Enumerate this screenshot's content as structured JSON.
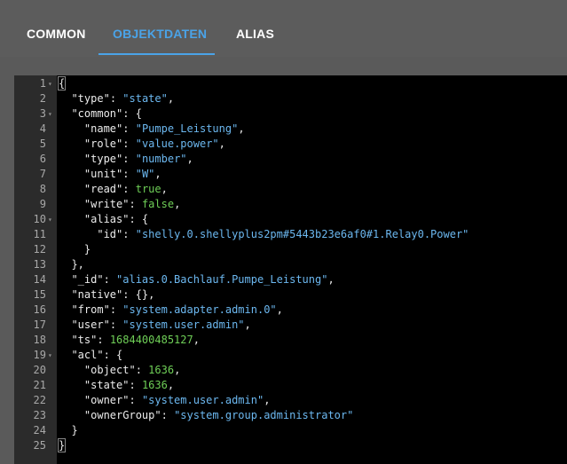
{
  "tabs": [
    {
      "label": "COMMON",
      "active": false
    },
    {
      "label": "OBJEKTDATEN",
      "active": true
    },
    {
      "label": "ALIAS",
      "active": false
    }
  ],
  "colors": {
    "accent": "#4aa3e8",
    "string": "#6cb8f0",
    "number": "#6fcf57",
    "key": "#ececec"
  },
  "lines": [
    {
      "num": "1",
      "fold": true,
      "tokens": [
        {
          "t": "p",
          "v": "{"
        }
      ]
    },
    {
      "num": "2",
      "fold": false,
      "tokens": [
        {
          "t": "p",
          "v": "  "
        },
        {
          "t": "k",
          "v": "\"type\""
        },
        {
          "t": "p",
          "v": ": "
        },
        {
          "t": "s",
          "v": "\"state\""
        },
        {
          "t": "p",
          "v": ","
        }
      ]
    },
    {
      "num": "3",
      "fold": true,
      "tokens": [
        {
          "t": "p",
          "v": "  "
        },
        {
          "t": "k",
          "v": "\"common\""
        },
        {
          "t": "p",
          "v": ": {"
        }
      ]
    },
    {
      "num": "4",
      "fold": false,
      "tokens": [
        {
          "t": "p",
          "v": "    "
        },
        {
          "t": "k",
          "v": "\"name\""
        },
        {
          "t": "p",
          "v": ": "
        },
        {
          "t": "s",
          "v": "\"Pumpe_Leistung\""
        },
        {
          "t": "p",
          "v": ","
        }
      ]
    },
    {
      "num": "5",
      "fold": false,
      "tokens": [
        {
          "t": "p",
          "v": "    "
        },
        {
          "t": "k",
          "v": "\"role\""
        },
        {
          "t": "p",
          "v": ": "
        },
        {
          "t": "s",
          "v": "\"value.power\""
        },
        {
          "t": "p",
          "v": ","
        }
      ]
    },
    {
      "num": "6",
      "fold": false,
      "tokens": [
        {
          "t": "p",
          "v": "    "
        },
        {
          "t": "k",
          "v": "\"type\""
        },
        {
          "t": "p",
          "v": ": "
        },
        {
          "t": "s",
          "v": "\"number\""
        },
        {
          "t": "p",
          "v": ","
        }
      ]
    },
    {
      "num": "7",
      "fold": false,
      "tokens": [
        {
          "t": "p",
          "v": "    "
        },
        {
          "t": "k",
          "v": "\"unit\""
        },
        {
          "t": "p",
          "v": ": "
        },
        {
          "t": "s",
          "v": "\"W\""
        },
        {
          "t": "p",
          "v": ","
        }
      ]
    },
    {
      "num": "8",
      "fold": false,
      "tokens": [
        {
          "t": "p",
          "v": "    "
        },
        {
          "t": "k",
          "v": "\"read\""
        },
        {
          "t": "p",
          "v": ": "
        },
        {
          "t": "b",
          "v": "true"
        },
        {
          "t": "p",
          "v": ","
        }
      ]
    },
    {
      "num": "9",
      "fold": false,
      "tokens": [
        {
          "t": "p",
          "v": "    "
        },
        {
          "t": "k",
          "v": "\"write\""
        },
        {
          "t": "p",
          "v": ": "
        },
        {
          "t": "b",
          "v": "false"
        },
        {
          "t": "p",
          "v": ","
        }
      ]
    },
    {
      "num": "10",
      "fold": true,
      "tokens": [
        {
          "t": "p",
          "v": "    "
        },
        {
          "t": "k",
          "v": "\"alias\""
        },
        {
          "t": "p",
          "v": ": {"
        }
      ]
    },
    {
      "num": "11",
      "fold": false,
      "tokens": [
        {
          "t": "p",
          "v": "      "
        },
        {
          "t": "k",
          "v": "\"id\""
        },
        {
          "t": "p",
          "v": ": "
        },
        {
          "t": "s",
          "v": "\"shelly.0.shellyplus2pm#5443b23e6af0#1.Relay0.Power\""
        }
      ]
    },
    {
      "num": "12",
      "fold": false,
      "tokens": [
        {
          "t": "p",
          "v": "    }"
        }
      ]
    },
    {
      "num": "13",
      "fold": false,
      "tokens": [
        {
          "t": "p",
          "v": "  },"
        }
      ]
    },
    {
      "num": "14",
      "fold": false,
      "tokens": [
        {
          "t": "p",
          "v": "  "
        },
        {
          "t": "k",
          "v": "\"_id\""
        },
        {
          "t": "p",
          "v": ": "
        },
        {
          "t": "s",
          "v": "\"alias.0.Bachlauf.Pumpe_Leistung\""
        },
        {
          "t": "p",
          "v": ","
        }
      ]
    },
    {
      "num": "15",
      "fold": false,
      "tokens": [
        {
          "t": "p",
          "v": "  "
        },
        {
          "t": "k",
          "v": "\"native\""
        },
        {
          "t": "p",
          "v": ": {},"
        }
      ]
    },
    {
      "num": "16",
      "fold": false,
      "tokens": [
        {
          "t": "p",
          "v": "  "
        },
        {
          "t": "k",
          "v": "\"from\""
        },
        {
          "t": "p",
          "v": ": "
        },
        {
          "t": "s",
          "v": "\"system.adapter.admin.0\""
        },
        {
          "t": "p",
          "v": ","
        }
      ]
    },
    {
      "num": "17",
      "fold": false,
      "tokens": [
        {
          "t": "p",
          "v": "  "
        },
        {
          "t": "k",
          "v": "\"user\""
        },
        {
          "t": "p",
          "v": ": "
        },
        {
          "t": "s",
          "v": "\"system.user.admin\""
        },
        {
          "t": "p",
          "v": ","
        }
      ]
    },
    {
      "num": "18",
      "fold": false,
      "tokens": [
        {
          "t": "p",
          "v": "  "
        },
        {
          "t": "k",
          "v": "\"ts\""
        },
        {
          "t": "p",
          "v": ": "
        },
        {
          "t": "n",
          "v": "1684400485127"
        },
        {
          "t": "p",
          "v": ","
        }
      ]
    },
    {
      "num": "19",
      "fold": true,
      "tokens": [
        {
          "t": "p",
          "v": "  "
        },
        {
          "t": "k",
          "v": "\"acl\""
        },
        {
          "t": "p",
          "v": ": {"
        }
      ]
    },
    {
      "num": "20",
      "fold": false,
      "tokens": [
        {
          "t": "p",
          "v": "    "
        },
        {
          "t": "k",
          "v": "\"object\""
        },
        {
          "t": "p",
          "v": ": "
        },
        {
          "t": "n",
          "v": "1636"
        },
        {
          "t": "p",
          "v": ","
        }
      ]
    },
    {
      "num": "21",
      "fold": false,
      "tokens": [
        {
          "t": "p",
          "v": "    "
        },
        {
          "t": "k",
          "v": "\"state\""
        },
        {
          "t": "p",
          "v": ": "
        },
        {
          "t": "n",
          "v": "1636"
        },
        {
          "t": "p",
          "v": ","
        }
      ]
    },
    {
      "num": "22",
      "fold": false,
      "tokens": [
        {
          "t": "p",
          "v": "    "
        },
        {
          "t": "k",
          "v": "\"owner\""
        },
        {
          "t": "p",
          "v": ": "
        },
        {
          "t": "s",
          "v": "\"system.user.admin\""
        },
        {
          "t": "p",
          "v": ","
        }
      ]
    },
    {
      "num": "23",
      "fold": false,
      "tokens": [
        {
          "t": "p",
          "v": "    "
        },
        {
          "t": "k",
          "v": "\"ownerGroup\""
        },
        {
          "t": "p",
          "v": ": "
        },
        {
          "t": "s",
          "v": "\"system.group.administrator\""
        }
      ]
    },
    {
      "num": "24",
      "fold": false,
      "tokens": [
        {
          "t": "p",
          "v": "  }"
        }
      ]
    },
    {
      "num": "25",
      "fold": false,
      "tokens": [
        {
          "t": "p",
          "v": "}"
        }
      ]
    }
  ]
}
